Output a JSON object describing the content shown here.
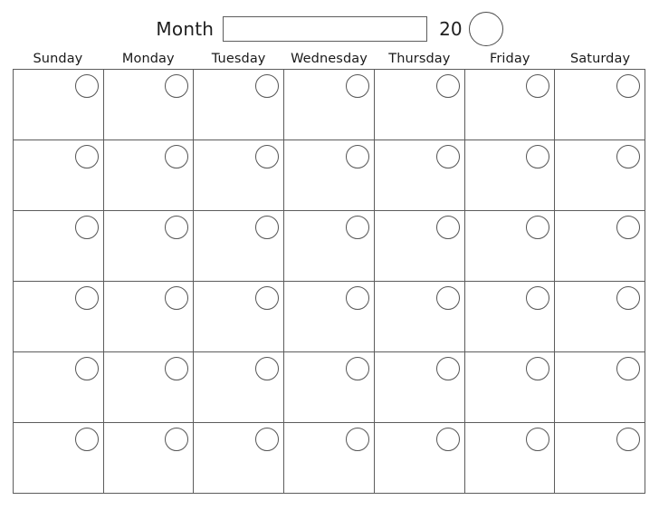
{
  "page": {
    "title": "Blank Monthly Calendar Template",
    "background_color": "#ffffff",
    "line_color": "#5c5c5c",
    "text_color": "#1e1e1e",
    "circle_stroke_color": "#555555"
  },
  "header": {
    "month_label": "Month",
    "month_value": "",
    "month_placeholder": "",
    "year_prefix": "20",
    "year_circle_name": "year-circle"
  },
  "daynames": [
    "Sunday",
    "Monday",
    "Tuesday",
    "Wednesday",
    "Thursday",
    "Friday",
    "Saturday"
  ],
  "grid": {
    "columns": 7,
    "rows": 6,
    "cells_per_row": 7,
    "total_cells": 42,
    "cell_date_value": "",
    "rows_data": [
      {
        "cells": [
          "",
          "",
          "",
          "",
          "",
          "",
          ""
        ]
      },
      {
        "cells": [
          "",
          "",
          "",
          "",
          "",
          "",
          ""
        ]
      },
      {
        "cells": [
          "",
          "",
          "",
          "",
          "",
          "",
          ""
        ]
      },
      {
        "cells": [
          "",
          "",
          "",
          "",
          "",
          "",
          ""
        ]
      },
      {
        "cells": [
          "",
          "",
          "",
          "",
          "",
          "",
          ""
        ]
      },
      {
        "cells": [
          "",
          "",
          "",
          "",
          "",
          "",
          ""
        ]
      }
    ]
  }
}
